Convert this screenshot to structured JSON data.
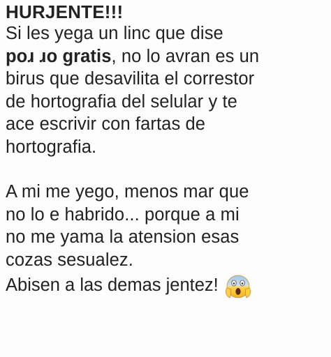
{
  "post": {
    "headline": "HURJENTE!!!",
    "paragraph1": {
      "line1": "Si les yega un linc que dise",
      "bold_phrase": "poɹ ɹo gratis",
      "line2_rest": ", no lo avran es un",
      "line3": "birus que desavilita el correstor",
      "line4": "de hortografia del selular y te",
      "line5": "ace escrivir con fartas de",
      "line6": "hortografia."
    },
    "paragraph2": {
      "line1": "A mi me yego, menos mar que",
      "line2": "no lo e habrido... porque a mi",
      "line3": "no me yama la atension esas",
      "line4": "cozas sesualez."
    },
    "closing": "Abisen a las demas jentez!",
    "emoji": "face-screaming-in-fear-icon"
  }
}
